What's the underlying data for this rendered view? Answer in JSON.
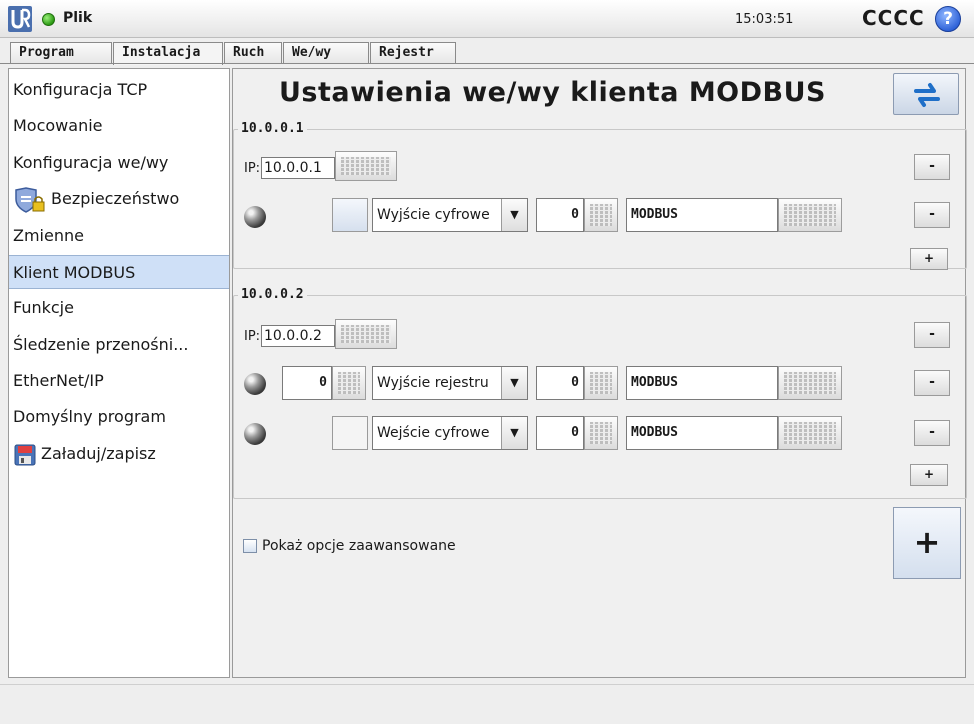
{
  "header": {
    "file_label": "Plik",
    "clock": "15:03:51",
    "robot_name": "CCCC",
    "help_label": "?",
    "status_color": "#3cb01e"
  },
  "tabs": [
    "Program",
    "Instalacja",
    "Ruch",
    "We/wy",
    "Rejestr"
  ],
  "active_tab": "Instalacja",
  "sidebar": {
    "items": [
      {
        "label": "Konfiguracja TCP"
      },
      {
        "label": "Mocowanie"
      },
      {
        "label": "Konfiguracja we/wy"
      },
      {
        "label": "Bezpieczeństwo",
        "icon": "shield-lock-icon"
      },
      {
        "label": "Zmienne"
      },
      {
        "label": "Klient MODBUS",
        "selected": true
      },
      {
        "label": "Funkcje"
      },
      {
        "label": "Śledzenie przenośni..."
      },
      {
        "label": "EtherNet/IP"
      },
      {
        "label": "Domyślny program"
      },
      {
        "label": "Załaduj/zapisz",
        "icon": "floppy-icon"
      }
    ]
  },
  "main": {
    "title": "Ustawienia we/wy klienta MODBUS",
    "ip_prefix": "IP:",
    "minus_label": "-",
    "plus_label": "+",
    "groups": [
      {
        "legend": "10.0.0.1",
        "ip": "10.0.0.1",
        "signals": [
          {
            "register_value": "",
            "type": "Wyjście cyfrowe",
            "address": "0",
            "name": "MODBUS"
          }
        ]
      },
      {
        "legend": "10.0.0.2",
        "ip": "10.0.0.2",
        "signals": [
          {
            "register_value": "0",
            "type": "Wyjście rejestru",
            "address": "0",
            "name": "MODBUS"
          },
          {
            "register_value": "",
            "type": "Wejście cyfrowe",
            "address": "0",
            "name": "MODBUS"
          }
        ]
      }
    ],
    "advanced_checkbox_label": "Pokaż opcje zaawansowane",
    "advanced_checked": false,
    "add_unit_label": "+"
  }
}
